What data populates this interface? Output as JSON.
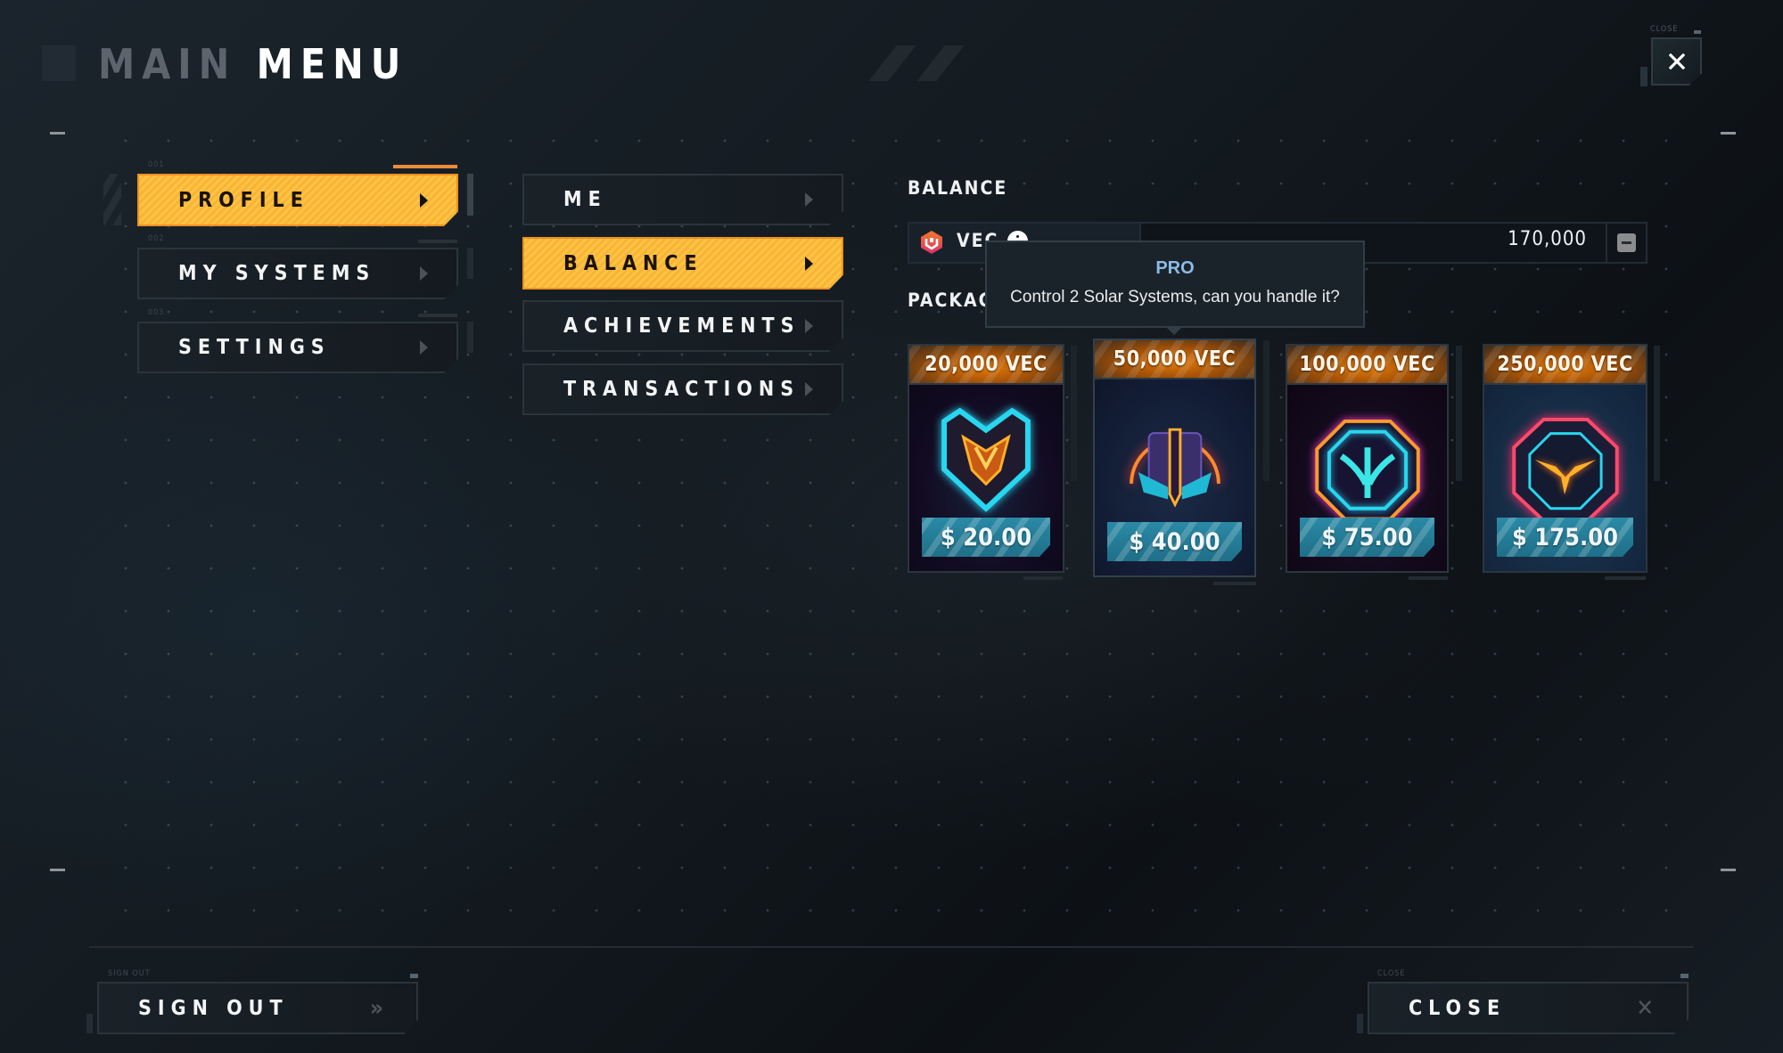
{
  "header": {
    "title_dim": "MAIN",
    "title_bright": "MENU",
    "close_label": "CLOSE",
    "close_icon": "close-icon"
  },
  "primary_menu": {
    "items": [
      {
        "index": "001",
        "label": "PROFILE",
        "active": true,
        "icon": "chevron-right-icon"
      },
      {
        "index": "002",
        "label": "MY SYSTEMS",
        "active": false,
        "icon": "chevron-right-icon"
      },
      {
        "index": "003",
        "label": "SETTINGS",
        "active": false,
        "icon": "chevron-right-icon"
      }
    ]
  },
  "secondary_menu": {
    "items": [
      {
        "label": "ME",
        "active": false,
        "icon": "chevron-right-icon"
      },
      {
        "label": "BALANCE",
        "active": true,
        "icon": "chevron-right-icon"
      },
      {
        "label": "ACHIEVEMENTS",
        "active": false,
        "icon": "chevron-right-icon"
      },
      {
        "label": "TRANSACTIONS",
        "active": false,
        "icon": "chevron-right-icon"
      }
    ]
  },
  "balance": {
    "section_title": "BALANCE",
    "currency": "VEC",
    "currency_icon": "vec-logo-icon",
    "info_icon": "info-icon",
    "value": "170,000",
    "minus_icon": "minus-icon"
  },
  "tooltip": {
    "title": "PRO",
    "body": "Control 2 Solar Systems, can you handle it?"
  },
  "packages": {
    "section_title": "PACKAGES",
    "items": [
      {
        "amount": "20,000 VEC",
        "price": "$ 20.00",
        "emblem": "heart-shield-emblem"
      },
      {
        "amount": "50,000 VEC",
        "price": "$ 40.00",
        "emblem": "sword-wings-emblem"
      },
      {
        "amount": "100,000 VEC",
        "price": "$ 75.00",
        "emblem": "octagon-wings-emblem"
      },
      {
        "amount": "250,000 VEC",
        "price": "$ 175.00",
        "emblem": "ring-wings-emblem"
      }
    ]
  },
  "footer": {
    "sign_out_caption": "SIGN OUT",
    "sign_out_label": "SIGN OUT",
    "sign_out_icon": "double-chevron-right-icon",
    "close_caption": "CLOSE",
    "close_label": "CLOSE",
    "close_icon": "close-icon"
  },
  "colors": {
    "accent": "#ffc43f",
    "accent_border": "#ef8f1f",
    "tooltip_title": "#8bbbe8",
    "price_badge": "#2a8aa6",
    "package_header": "#e0790b"
  }
}
